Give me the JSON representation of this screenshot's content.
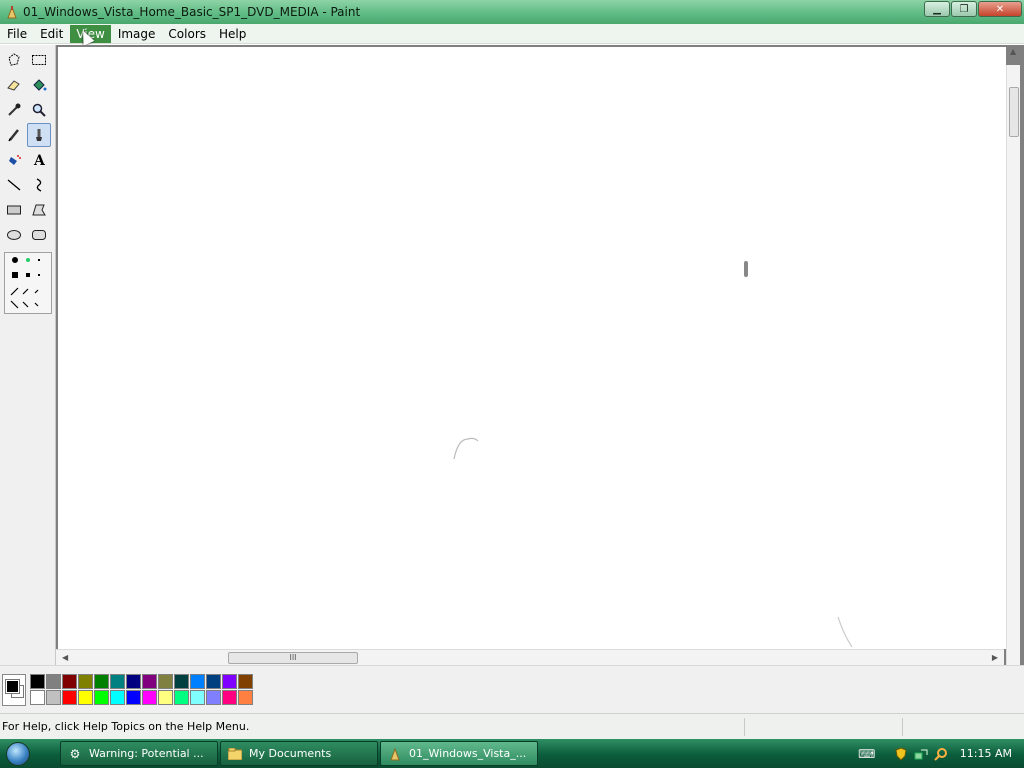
{
  "window": {
    "title": "01_Windows_Vista_Home_Basic_SP1_DVD_MEDIA - Paint",
    "icon": "paint-icon"
  },
  "menu": {
    "items": [
      "File",
      "Edit",
      "View",
      "Image",
      "Colors",
      "Help"
    ],
    "active": "View"
  },
  "toolbox": {
    "tools": [
      "free-form-select-icon",
      "select-icon",
      "eraser-icon",
      "fill-bucket-icon",
      "pick-color-icon",
      "magnifier-icon",
      "pencil-icon",
      "brush-icon",
      "airbrush-icon",
      "text-icon",
      "line-icon",
      "curve-icon",
      "rectangle-icon",
      "polygon-icon",
      "ellipse-icon",
      "rounded-rectangle-icon"
    ],
    "selected": "brush-icon"
  },
  "palette": {
    "foreground": "#000000",
    "background": "#ffffff",
    "colors": [
      "#000000",
      "#808080",
      "#800000",
      "#808000",
      "#008000",
      "#008080",
      "#000080",
      "#800080",
      "#808040",
      "#004040",
      "#0080ff",
      "#004080",
      "#8000ff",
      "#804000",
      "#ffffff",
      "#c0c0c0",
      "#ff0000",
      "#ffff00",
      "#00ff00",
      "#00ffff",
      "#0000ff",
      "#ff00ff",
      "#ffff80",
      "#00ff80",
      "#80ffff",
      "#8080ff",
      "#ff0080",
      "#ff8040"
    ]
  },
  "status": {
    "text": "For Help, click Help Topics on the Help Menu."
  },
  "taskbar": {
    "buttons": [
      {
        "label": "Warning: Potential ...",
        "icon": "warning-icon"
      },
      {
        "label": "My Documents",
        "icon": "folder-icon"
      },
      {
        "label": "01_Windows_Vista_...",
        "icon": "paint-icon"
      }
    ],
    "active_index": 2,
    "clock": "11:15 AM"
  },
  "scrollbar": {
    "h_thumb_grip": "III"
  }
}
